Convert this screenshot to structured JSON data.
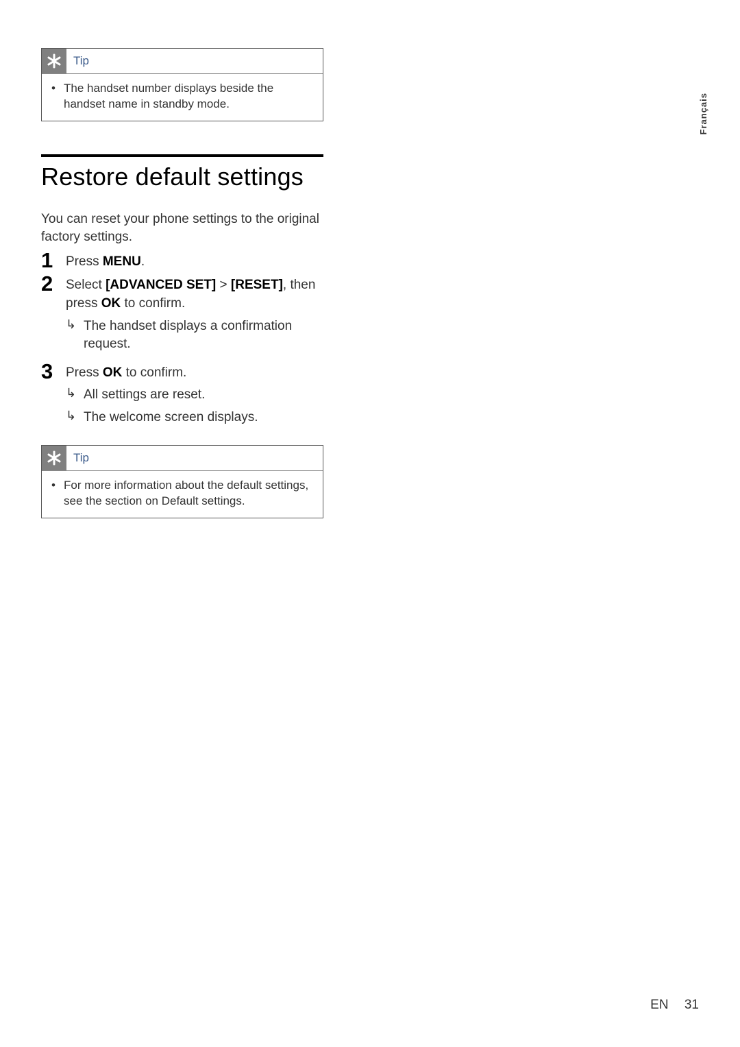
{
  "tip1": {
    "label": "Tip",
    "text": "The handset number displays beside the handset name in standby mode."
  },
  "section": {
    "title": "Restore default settings",
    "intro": "You can reset your phone settings to the original factory settings.",
    "steps": [
      {
        "num": "1",
        "text_pre": "Press ",
        "bold1": "MENU",
        "text_post": ".",
        "results": []
      },
      {
        "num": "2",
        "text_pre": "Select ",
        "bold1": "[ADVANCED SET]",
        "text_mid": " > ",
        "bold2": "[RESET]",
        "text_post": ", then press ",
        "bold3": "OK",
        "text_end": " to confirm.",
        "results": [
          "The handset displays a confirmation request."
        ]
      },
      {
        "num": "3",
        "text_pre": "Press ",
        "bold1": "OK",
        "text_post": " to confirm.",
        "results": [
          "All settings are reset.",
          "The welcome screen displays."
        ]
      }
    ]
  },
  "tip2": {
    "label": "Tip",
    "text": "For more information about the default settings, see the section on Default settings."
  },
  "side_label": "Français",
  "footer": {
    "lang": "EN",
    "page": "31"
  }
}
